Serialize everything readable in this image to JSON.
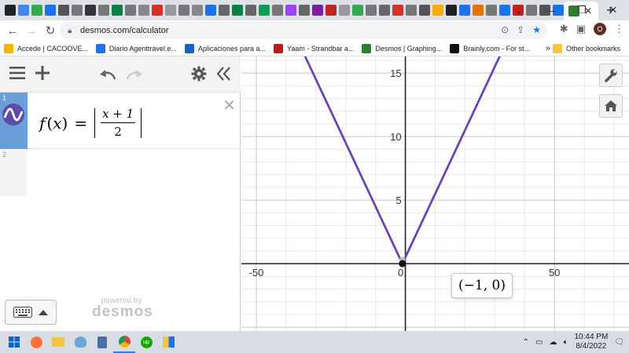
{
  "browser": {
    "tab_favicon_colors": [
      "#222222",
      "#4285f4",
      "#34a853",
      "#1a73e8",
      "#555555",
      "#777777",
      "#333333",
      "#777777",
      "#0b8043",
      "#777777",
      "#888888",
      "#d93025",
      "#999999",
      "#777777",
      "#888888",
      "#1a73e8",
      "#666666",
      "#0b8043",
      "#666666",
      "#0f9d58",
      "#777777",
      "#a142f4",
      "#666666",
      "#7b1fa2",
      "#c5221f",
      "#999999",
      "#34a853",
      "#777777",
      "#666666",
      "#d93025",
      "#777777",
      "#555555",
      "#f9ab00",
      "#202124",
      "#1a73e8",
      "#e37400",
      "#777777",
      "#1a73e8",
      "#c5221f",
      "#777777",
      "#555555",
      "#1a73e8"
    ],
    "url": "desmos.com/calculator",
    "new_tab_label": "+",
    "bookmarks": [
      {
        "label": "Accede | CACOOVE...",
        "color": "#f4b400"
      },
      {
        "label": "Diario Agenttravel.e...",
        "color": "#1a73e8"
      },
      {
        "label": "Aplicaciones para a...",
        "color": "#1565c0"
      },
      {
        "label": "Yaam - Strandbar a...",
        "color": "#b71c1c"
      },
      {
        "label": "Desmos | Graphing...",
        "color": "#2e7d32"
      },
      {
        "label": "Brainly.com - For st...",
        "color": "#111111"
      }
    ],
    "bookmarks_more": "»",
    "other_bookmarks": "Other bookmarks",
    "avatar_letter": "O"
  },
  "desmos": {
    "expressions": [
      {
        "index": "1",
        "func": "f",
        "var": "x",
        "numerator": "x + 1",
        "denominator": "2"
      },
      {
        "index": "2"
      }
    ],
    "brand_top": "powered by",
    "brand_name": "desmos",
    "point_label": "(−1, 0)",
    "graph": {
      "x_range": [
        -55,
        75
      ],
      "y_range": [
        -5.3,
        16.3
      ],
      "x_tick_labels": [
        "-50",
        "0",
        "50"
      ],
      "y_tick_labels": [
        "5",
        "10",
        "15"
      ],
      "curve_color": "#6b46b3",
      "vertex": [
        -1,
        0
      ],
      "function": "|(x+1)/2|"
    }
  },
  "taskbar": {
    "time": "10:44 PM",
    "date": "8/4/2022"
  }
}
